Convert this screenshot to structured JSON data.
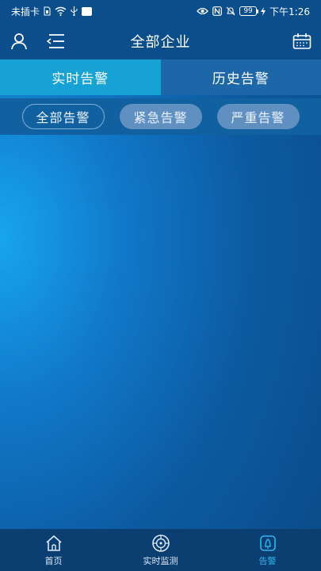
{
  "status_bar": {
    "carrier": "未插卡",
    "battery": "99",
    "time": "下午1:26"
  },
  "header": {
    "title": "全部企业"
  },
  "tabs": [
    {
      "label": "实时告警",
      "active": true
    },
    {
      "label": "历史告警",
      "active": false
    }
  ],
  "filters": [
    {
      "label": "全部告警",
      "selected": true
    },
    {
      "label": "紧急告警",
      "selected": false
    },
    {
      "label": "严重告警",
      "selected": false
    }
  ],
  "bottom_nav": [
    {
      "label": "首页",
      "icon": "home-icon",
      "active": false
    },
    {
      "label": "实时监测",
      "icon": "monitor-icon",
      "active": false
    },
    {
      "label": "告警",
      "icon": "alarm-icon",
      "active": true
    }
  ],
  "colors": {
    "accent": "#2fb6ee",
    "tab_active": "#17a2d6",
    "header_bg": "#0b4e8b"
  }
}
